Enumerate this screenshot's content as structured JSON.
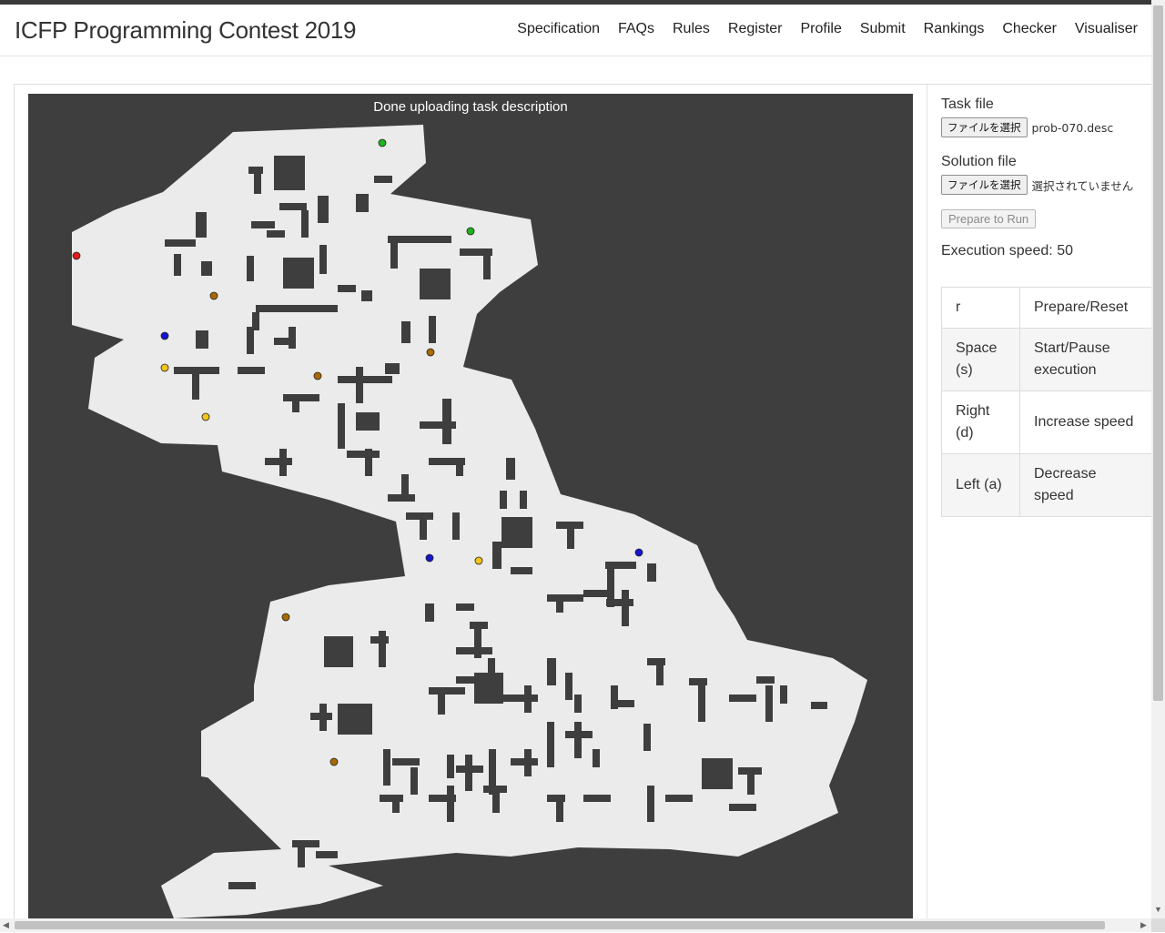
{
  "header": {
    "brand": "ICFP Programming Contest 2019",
    "nav": [
      "Specification",
      "FAQs",
      "Rules",
      "Register",
      "Profile",
      "Submit",
      "Rankings",
      "Checker",
      "Visualiser"
    ]
  },
  "canvas": {
    "status": "Done uploading task description",
    "colors": {
      "background": "#3e3e3e",
      "land": "#ebebeb",
      "wall": "#3e3e3e"
    },
    "boosters": [
      {
        "type": "worker",
        "color": "#e01b1b"
      },
      {
        "type": "green",
        "color": "#1fb31f"
      },
      {
        "type": "green",
        "color": "#1fb31f"
      },
      {
        "type": "blue",
        "color": "#1414cf"
      },
      {
        "type": "blue",
        "color": "#1414cf"
      },
      {
        "type": "blue",
        "color": "#1414cf"
      },
      {
        "type": "brown",
        "color": "#a86a00"
      },
      {
        "type": "brown",
        "color": "#a86a00"
      },
      {
        "type": "brown",
        "color": "#a86a00"
      },
      {
        "type": "brown",
        "color": "#a86a00"
      },
      {
        "type": "brown",
        "color": "#a86a00"
      },
      {
        "type": "yellow",
        "color": "#f0c419"
      },
      {
        "type": "yellow",
        "color": "#f0c419"
      },
      {
        "type": "yellow",
        "color": "#f0c419"
      }
    ]
  },
  "sidebar": {
    "task_label": "Task file",
    "task_button": "ファイルを選択",
    "task_filename": "prob-070.desc",
    "solution_label": "Solution file",
    "solution_button": "ファイルを選択",
    "solution_filename": "選択されていません",
    "prepare_button": "Prepare to Run",
    "speed_text": "Execution speed: 50"
  },
  "shortcuts": [
    {
      "key": "r",
      "action": "Prepare/Reset"
    },
    {
      "key": "Space (s)",
      "action": "Start/Pause execution"
    },
    {
      "key": "Right (d)",
      "action": "Increase speed"
    },
    {
      "key": "Left (a)",
      "action": "Decrease speed"
    }
  ]
}
